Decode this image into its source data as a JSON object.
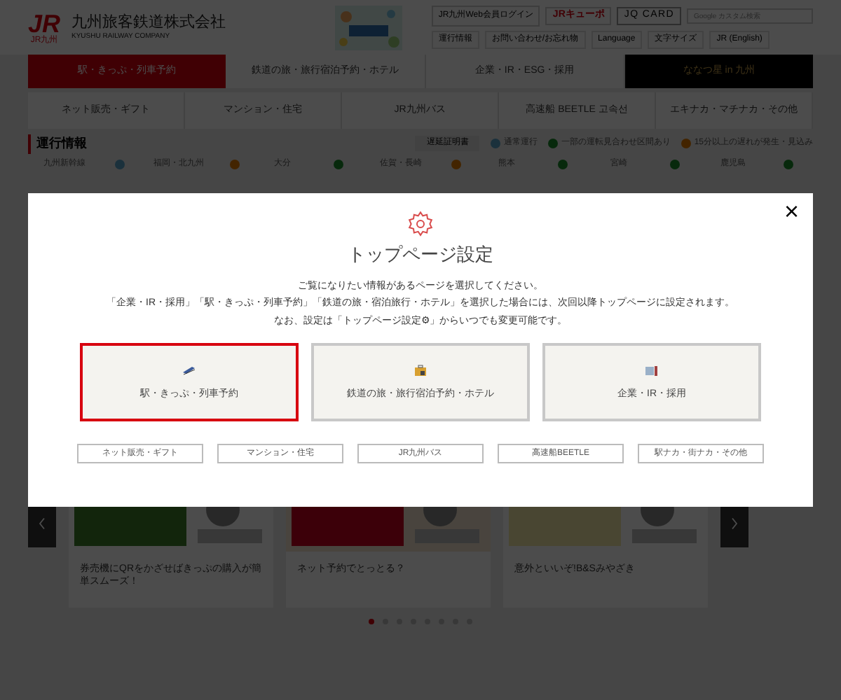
{
  "header": {
    "logo": "JR",
    "logo_sub": "JR九州",
    "company": "九州旅客鉄道株式会社",
    "company_en": "KYUSHU RAILWAY COMPANY",
    "top_links": [
      "JR九州Web会員ログイン",
      "JRキューポ",
      "JQ CARD"
    ],
    "search": {
      "placeholder": "Google カスタム検索"
    },
    "sub_links": [
      "運行情報",
      "お問い合わせ/お忘れ物",
      "Language",
      "文字サイズ",
      "JR (English)"
    ]
  },
  "main_nav": [
    {
      "label": "駅・きっぷ・列車予約",
      "selected": true
    },
    {
      "label": "鉄道の旅・旅行宿泊予約・ホテル",
      "selected": false
    },
    {
      "label": "企業・IR・ESG・採用",
      "selected": false
    }
  ],
  "promo": {
    "label": "ななつ星 in 九州"
  },
  "sub_nav": [
    "ネット販売・ギフト",
    "マンション・住宅",
    "JR九州バス",
    "高速船 BEETLE 고속선",
    "エキナカ・マチナカ・その他"
  ],
  "operation": {
    "title": "運行情報",
    "certificate": "遅延証明書",
    "legend": [
      {
        "kind": "normal",
        "label": "通常運行"
      },
      {
        "kind": "partial",
        "label": "一部の運転見合わせ区間あり"
      },
      {
        "kind": "delay",
        "label": "15分以上の遅れが発生・見込み"
      }
    ],
    "lines": [
      {
        "name": "九州新幹線",
        "kind": "normal"
      },
      {
        "name": "福岡・北九州",
        "kind": "delay"
      },
      {
        "name": "大分",
        "kind": "partial"
      },
      {
        "name": "佐賀・長崎",
        "kind": "delay"
      },
      {
        "name": "熊本",
        "kind": "partial"
      },
      {
        "name": "宮崎",
        "kind": "partial"
      },
      {
        "name": "鹿児島",
        "kind": "partial"
      }
    ]
  },
  "carousel": {
    "cards": [
      {
        "caption": "券売機にQRをかざせばきっぷの購入が簡単スムーズ！"
      },
      {
        "caption": "ネット予約でとっとる？"
      },
      {
        "caption": "意外といいぞ!B&Sみやざき"
      }
    ],
    "dots": [
      {
        "selected": true
      },
      {
        "selected": false
      },
      {
        "selected": false
      },
      {
        "selected": false
      },
      {
        "selected": false
      },
      {
        "selected": false
      },
      {
        "selected": false
      },
      {
        "selected": false
      }
    ]
  },
  "dialog": {
    "title": "トップページ設定",
    "close": "×",
    "message": [
      "ご覧になりたい情報があるページを選択してください。",
      "「企業・IR・採用」「駅・きっぷ・列車予約」「鉄道の旅・宿泊旅行・ホテル」を選択した場合には、次回以降トップページに設定されます。",
      "なお、設定は「トップページ設定⚙」からいつでも変更可能です。"
    ],
    "options": [
      {
        "label": "駅・きっぷ・列車予約",
        "kind": "train",
        "selected": true
      },
      {
        "label": "鉄道の旅・旅行宿泊予約・ホテル",
        "kind": "bag",
        "selected": false
      },
      {
        "label": "企業・IR・採用",
        "kind": "office",
        "selected": false
      }
    ],
    "links": [
      "ネット販売・ギフト",
      "マンション・住宅",
      "JR九州バス",
      "高速船BEETLE",
      "駅ナカ・街ナカ・その他"
    ]
  }
}
